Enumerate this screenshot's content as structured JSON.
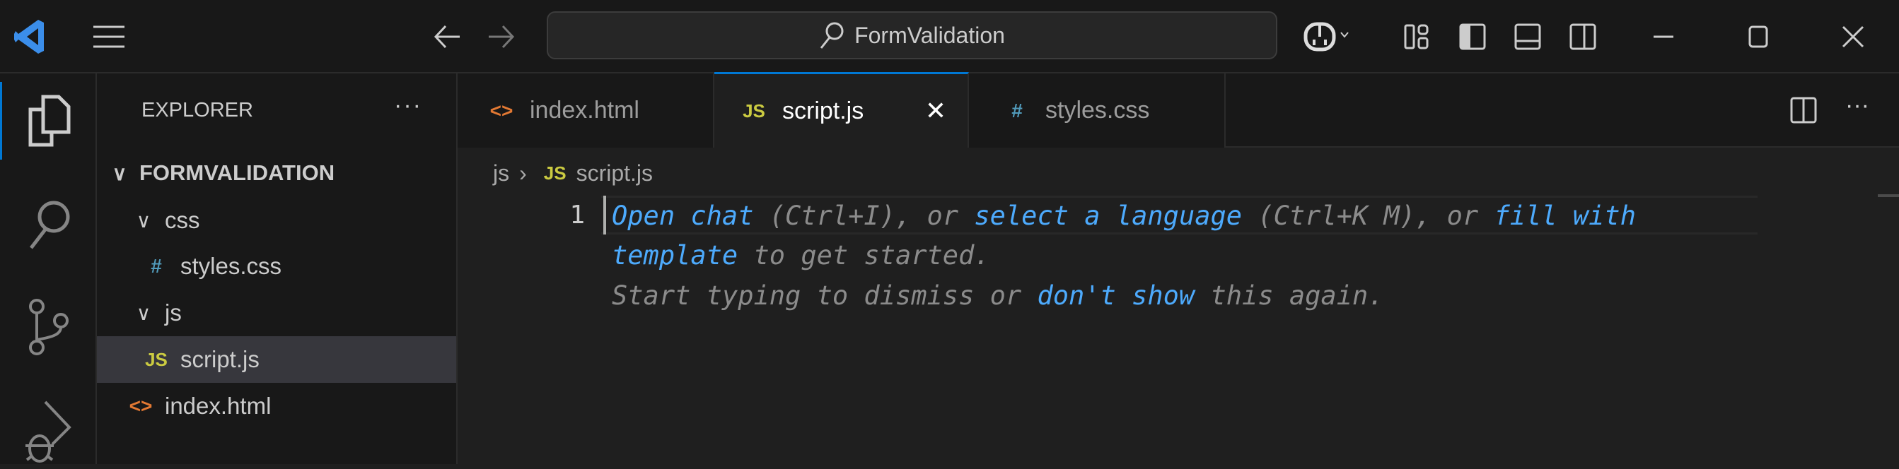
{
  "titlebar": {
    "search_text": "FormValidation",
    "icons": [
      "vscode-logo-icon",
      "menu-icon",
      "back-arrow-icon",
      "forward-arrow-icon",
      "search-icon",
      "copilot-icon",
      "chevron-down-icon",
      "customize-layout-icon",
      "toggle-primary-sidebar-icon",
      "toggle-panel-icon",
      "toggle-secondary-sidebar-icon",
      "minimize-icon",
      "maximize-icon",
      "close-icon"
    ]
  },
  "activity_bar": [
    "explorer-icon",
    "search-icon",
    "source-control-icon",
    "run-debug-icon"
  ],
  "sidebar": {
    "title": "EXPLORER",
    "more": "···",
    "folder": "FORMVALIDATION",
    "items": [
      {
        "label": "css",
        "type": "folder"
      },
      {
        "label": "styles.css",
        "type": "css",
        "icon_text": "#"
      },
      {
        "label": "js",
        "type": "folder"
      },
      {
        "label": "script.js",
        "type": "js",
        "icon_text": "JS",
        "selected": true
      },
      {
        "label": "index.html",
        "type": "html",
        "icon_text": "<>"
      }
    ]
  },
  "tabs": [
    {
      "label": "index.html",
      "icon_text": "<>"
    },
    {
      "label": "script.js",
      "icon_text": "JS",
      "active": true,
      "close": "✕"
    },
    {
      "label": "styles.css",
      "icon_text": "#"
    }
  ],
  "tab_actions": {
    "more": "···"
  },
  "breadcrumb": {
    "folder": "js",
    "separator": "›",
    "icon_text": "JS",
    "file": "script.js"
  },
  "editor": {
    "line_number": "1",
    "hint": {
      "open_chat": "Open chat",
      "t1": " (Ctrl+I), or ",
      "select_language": "select a language",
      "t2": " (Ctrl+K M), or ",
      "fill_with": "fill with",
      "template": "template",
      "t3": " to get started.",
      "t4": "Start typing to dismiss or ",
      "dont_show": "don't show",
      "t5": " this again."
    }
  },
  "colors": {
    "accent": "#0078d4",
    "link": "#4daafc",
    "js": "#cbcb41",
    "css": "#519aba",
    "html": "#e37933"
  }
}
